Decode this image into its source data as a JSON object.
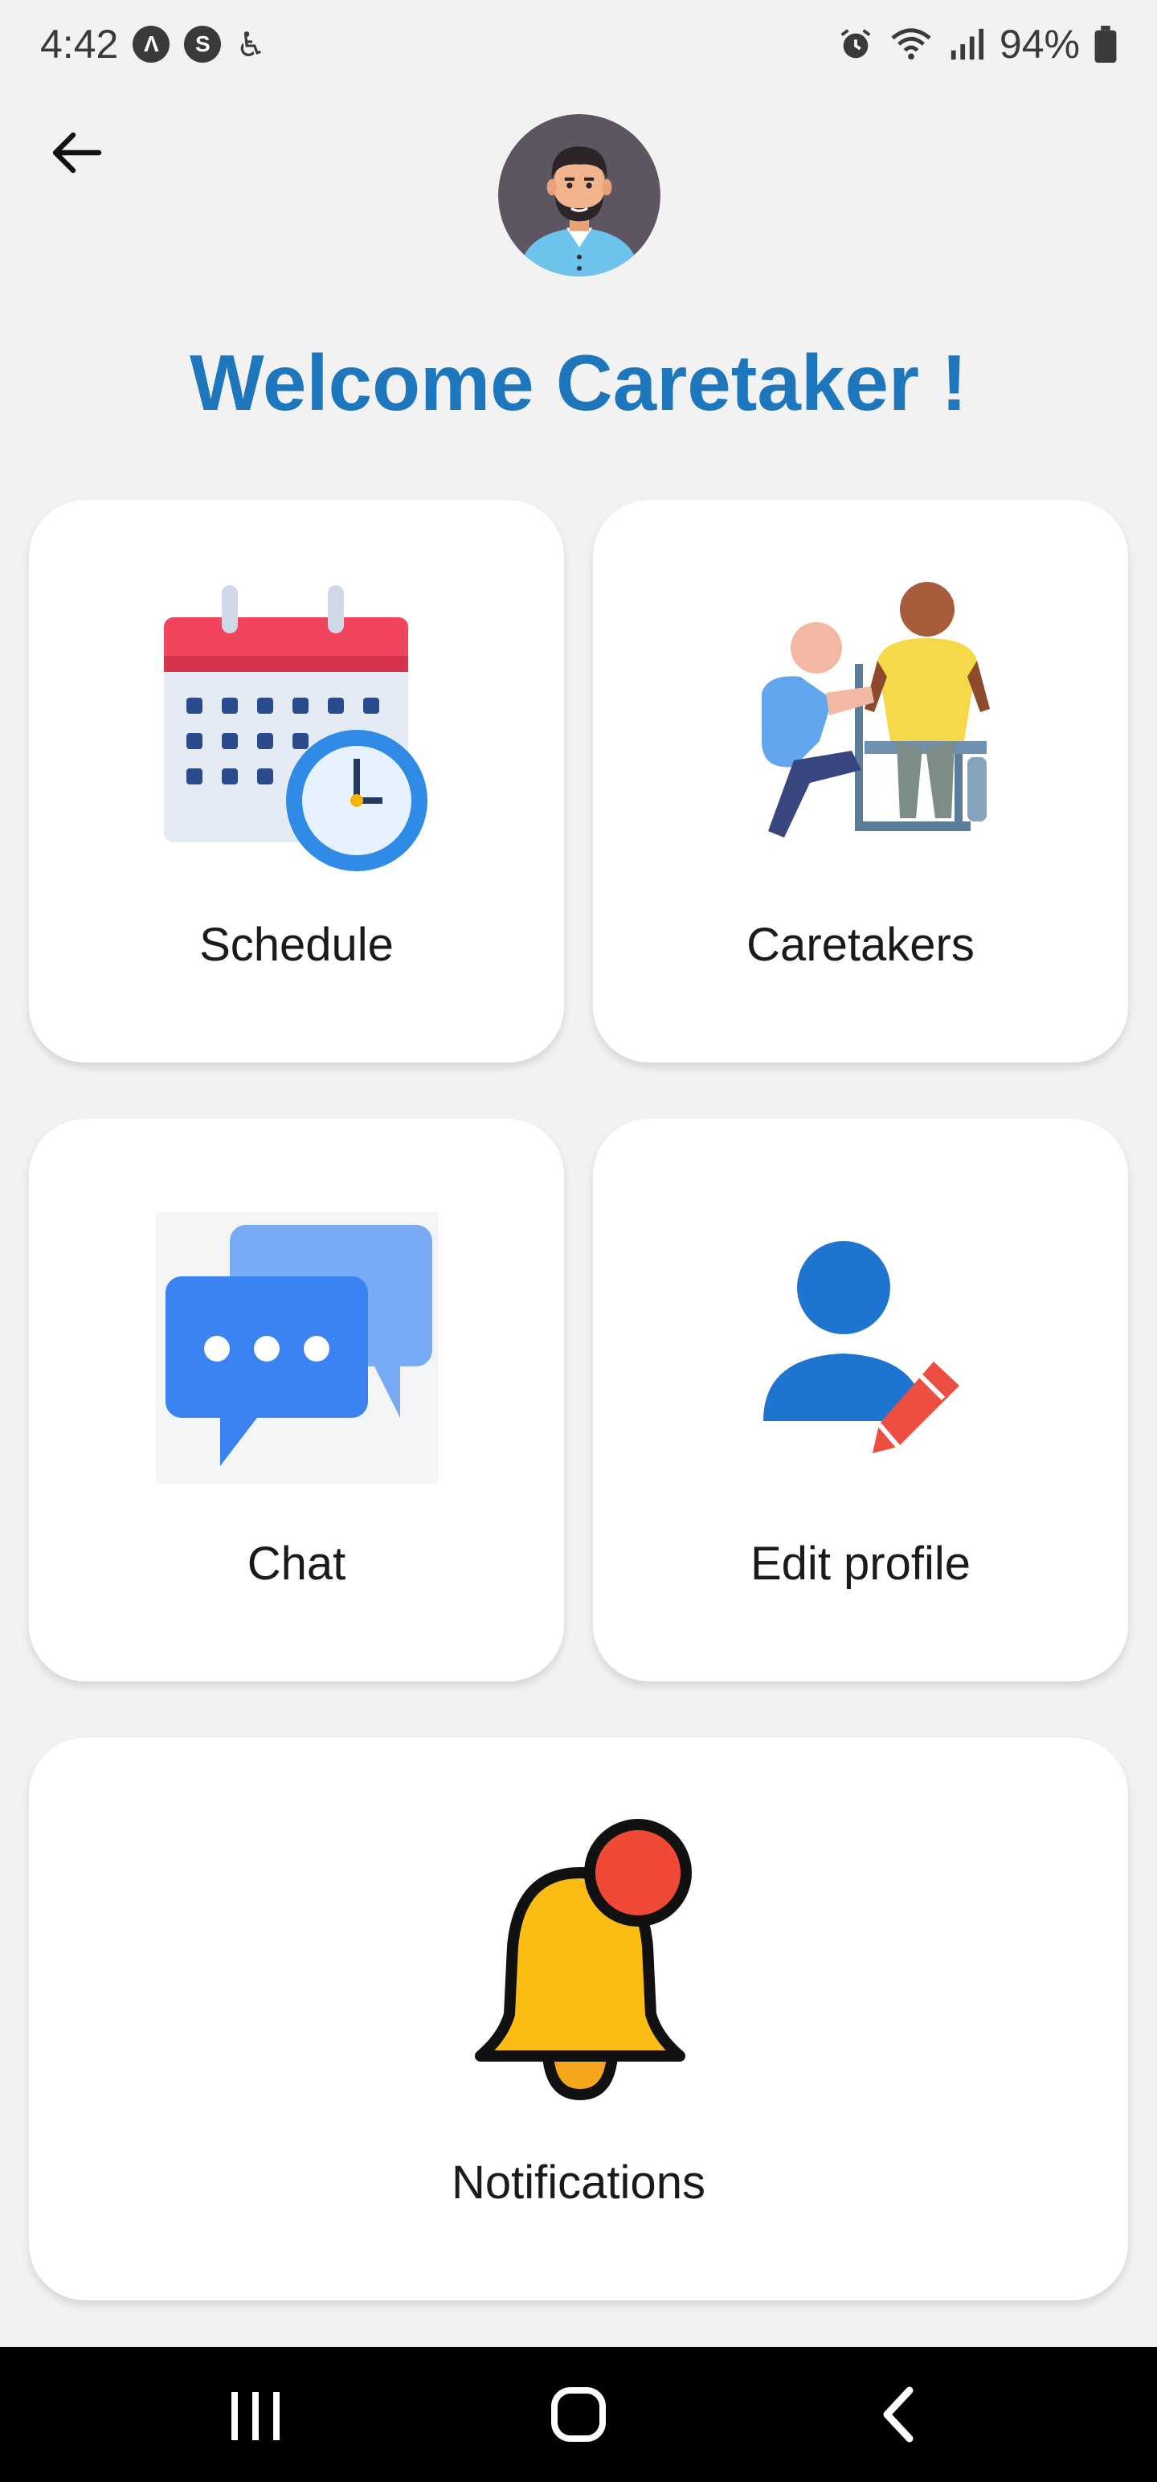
{
  "status_bar": {
    "time": "4:42",
    "battery": "94%",
    "left_icons": [
      "app-a-icon",
      "app-s-icon",
      "accessibility-icon"
    ],
    "right_icons": [
      "alarm-icon",
      "wifi-icon",
      "signal-icon",
      "battery-icon"
    ]
  },
  "header": {
    "welcome": "Welcome Caretaker !"
  },
  "cards": {
    "schedule": "Schedule",
    "caretakers": "Caretakers",
    "chat": "Chat",
    "edit_profile": "Edit profile",
    "notifications": "Notifications"
  },
  "colors": {
    "accent": "#1e76bd",
    "background": "#f2f2f2",
    "card": "#ffffff"
  }
}
